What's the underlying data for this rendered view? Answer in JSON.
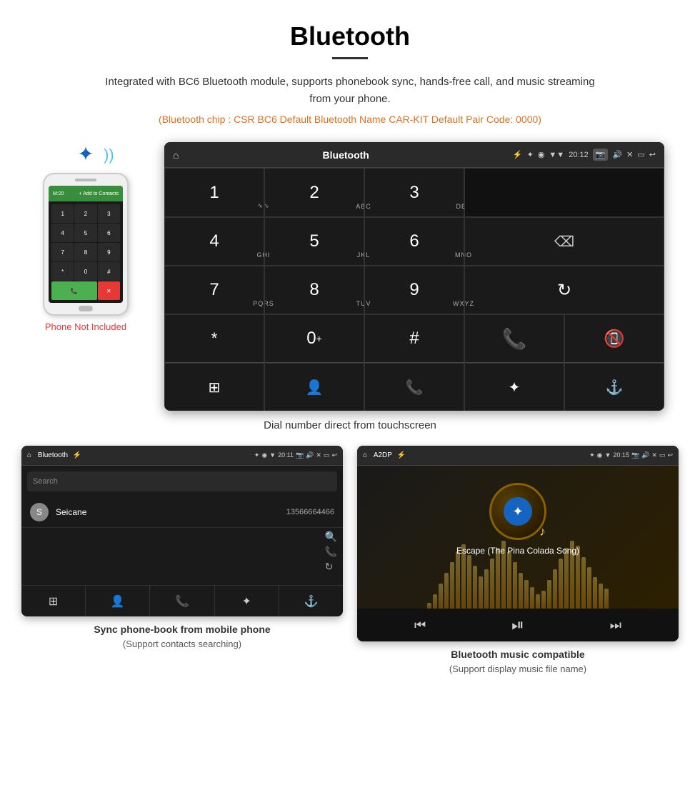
{
  "page": {
    "title": "Bluetooth",
    "description": "Integrated with BC6 Bluetooth module, supports phonebook sync, hands-free call, and music streaming from your phone.",
    "specs": "(Bluetooth chip : CSR BC6   Default Bluetooth Name CAR-KIT    Default Pair Code: 0000)",
    "phone_not_included": "Phone Not Included"
  },
  "dial_screen": {
    "topbar": {
      "home_icon": "⌂",
      "title": "Bluetooth",
      "usb_icon": "⚡",
      "bt_icon": "✦",
      "gps_icon": "◉",
      "signal_icon": "▼",
      "time": "20:12",
      "camera_icon": "📷",
      "volume_icon": "🔊",
      "close_icon": "✕",
      "screen_icon": "▭",
      "back_icon": "↩"
    },
    "keys": [
      {
        "num": "1",
        "sub": "∿∿"
      },
      {
        "num": "2",
        "sub": "ABC"
      },
      {
        "num": "3",
        "sub": "DEF"
      },
      {
        "num": "4",
        "sub": "GHI"
      },
      {
        "num": "5",
        "sub": "JKL"
      },
      {
        "num": "6",
        "sub": "MNO"
      },
      {
        "num": "7",
        "sub": "PQRS"
      },
      {
        "num": "8",
        "sub": "TUV"
      },
      {
        "num": "9",
        "sub": "WXYZ"
      },
      {
        "num": "*",
        "sub": ""
      },
      {
        "num": "0",
        "sub": "+"
      },
      {
        "num": "#",
        "sub": ""
      }
    ],
    "caption": "Dial number direct from touchscreen"
  },
  "phonebook_screen": {
    "topbar_title": "Bluetooth",
    "time": "20:11",
    "search_placeholder": "Search",
    "contact": {
      "letter": "S",
      "name": "Seicane",
      "number": "13566664466"
    },
    "caption_line1": "Sync phone-book from mobile phone",
    "caption_line2": "(Support contacts searching)"
  },
  "music_screen": {
    "topbar_title": "A2DP",
    "time": "20:15",
    "song_title": "Escape (The Pina Colada Song)",
    "caption_line1": "Bluetooth music compatible",
    "caption_line2": "(Support display music file name)"
  },
  "bottom_nav": {
    "grid_icon": "⊞",
    "contact_icon": "👤",
    "phone_icon": "📞",
    "bluetooth_icon": "✦",
    "link_icon": "⚓"
  },
  "eq_bars": [
    8,
    20,
    35,
    50,
    65,
    80,
    90,
    75,
    60,
    45,
    55,
    70,
    85,
    95,
    80,
    65,
    50,
    40,
    30,
    20,
    25,
    40,
    55,
    70,
    85,
    95,
    88,
    72,
    58,
    44,
    35,
    28
  ]
}
